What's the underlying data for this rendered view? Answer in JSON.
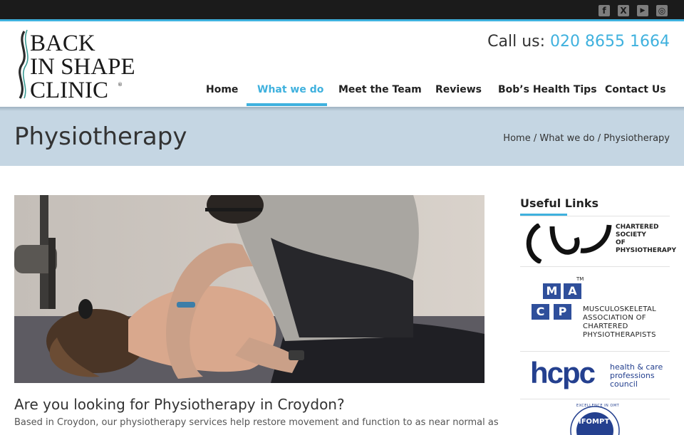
{
  "social": {
    "icons": [
      "facebook-icon",
      "x-icon",
      "youtube-icon",
      "instagram-icon"
    ],
    "glyphs": [
      "f",
      "X",
      "▶",
      "◎"
    ]
  },
  "header": {
    "logo_lines": [
      "BACK",
      "IN SHAPE",
      "CLINIC"
    ],
    "call_label": "Call us:",
    "call_number": "020 8655 1664"
  },
  "nav": {
    "items": [
      {
        "label": "Home",
        "active": false
      },
      {
        "label": "What we do",
        "active": true
      },
      {
        "label": "Meet the Team",
        "active": false
      },
      {
        "label": "Reviews",
        "active": false
      },
      {
        "label": "Bob’s Health Tips",
        "active": false
      },
      {
        "label": "Contact Us",
        "active": false
      }
    ]
  },
  "title_band": {
    "title": "Physiotherapy",
    "breadcrumb": [
      "Home",
      "What we do",
      "Physiotherapy"
    ],
    "separator": "/"
  },
  "main": {
    "heading": "Are you looking for Physiotherapy in Croydon?",
    "paragraph": "Based in Croydon, our physiotherapy services help restore movement and function to as near normal as possible"
  },
  "sidebar": {
    "title": "Useful Links",
    "links": [
      {
        "name": "CSP",
        "text": "CHARTERED\nSOCIETY\nOF\nPHYSIOTHERAPY"
      },
      {
        "name": "MACP",
        "letters": [
          "M",
          "A",
          "C",
          "P"
        ],
        "tm": "TM",
        "text": "MUSCULOSKELETAL\nASSOCIATION OF\nCHARTERED\nPHYSIOTHERAPISTS"
      },
      {
        "name": "HCPC",
        "mark": "hcpc",
        "text": "health & care\nprofessions\ncouncil"
      },
      {
        "name": "IFOMPT",
        "mark": "IFOMPT",
        "arc_text": "EXCELLENCE IN OMT"
      }
    ]
  },
  "colors": {
    "accent": "#3fb1de",
    "topbar": "#1b1b1b",
    "band": "#c5d6e3",
    "macp_blue": "#2f4f9b",
    "hcpc_blue": "#24408f"
  }
}
